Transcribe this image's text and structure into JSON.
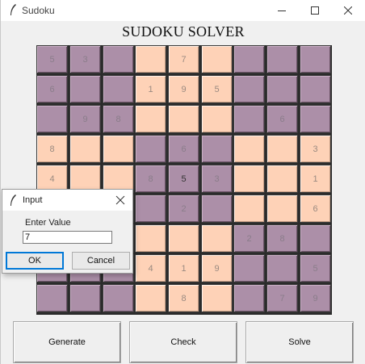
{
  "window": {
    "title": "Sudoku"
  },
  "heading": "SUDOKU SOLVER",
  "colors": {
    "purple": "#ac8fa8",
    "peach": "#fed2b7"
  },
  "board": {
    "rows": [
      [
        "5",
        "3",
        "",
        "",
        "7",
        "",
        "",
        "",
        ""
      ],
      [
        "6",
        "",
        "",
        "1",
        "9",
        "5",
        "",
        "",
        ""
      ],
      [
        "",
        "9",
        "8",
        "",
        "",
        "",
        "",
        "6",
        ""
      ],
      [
        "8",
        "",
        "",
        "",
        "6",
        "",
        "",
        "",
        "3"
      ],
      [
        "4",
        "",
        "",
        "8",
        "5",
        "3",
        "",
        "",
        "1"
      ],
      [
        "",
        "",
        "",
        "",
        "2",
        "",
        "",
        "",
        "6"
      ],
      [
        "",
        "",
        "",
        "",
        "",
        "",
        "2",
        "8",
        ""
      ],
      [
        "",
        "",
        "",
        "4",
        "1",
        "9",
        "",
        "",
        "5"
      ],
      [
        "",
        "",
        "",
        "",
        "8",
        "",
        "",
        "7",
        "9"
      ]
    ],
    "highlight": {
      "row": 4,
      "col": 4
    }
  },
  "buttons": {
    "generate": "Generate",
    "check": "Check",
    "solve": "Solve"
  },
  "dialog": {
    "title": "Input",
    "label": "Enter Value",
    "value": "7",
    "ok": "OK",
    "cancel": "Cancel"
  }
}
